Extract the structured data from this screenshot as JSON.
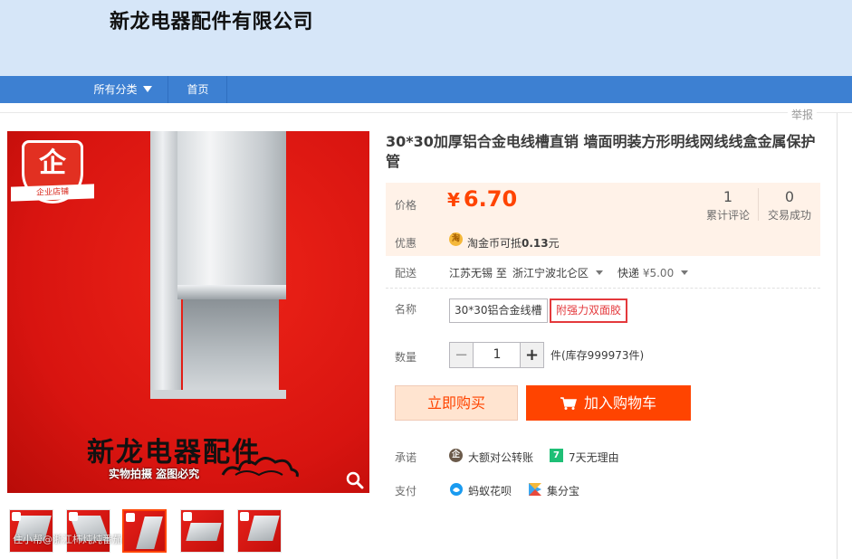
{
  "shop": {
    "name": "新龙电器配件有限公司"
  },
  "nav": {
    "all_categories": "所有分类",
    "home": "首页"
  },
  "report": "举报",
  "product": {
    "title": "30*30加厚铝合金电线槽直销 墙面明装方形明线网线线盒金属保护管",
    "image": {
      "badge_glyph": "企",
      "badge_text": "企业店铺",
      "calligraphy": "新龙电器配件",
      "slogan": "实物拍摄  盗图必究"
    },
    "thumbnails_count": 5,
    "active_thumbnail": 3,
    "watermark": "住小帮@浙江柿炖炖番茄"
  },
  "price": {
    "label": "价格",
    "currency": "¥",
    "value": "6.70",
    "reviews_count": "1",
    "reviews_label": "累计评论",
    "sales_count": "0",
    "sales_label": "交易成功"
  },
  "promo": {
    "label": "优惠",
    "icon_text": "淘",
    "text_prefix": "淘金币可抵",
    "amount": "0.13",
    "text_suffix": "元"
  },
  "shipping": {
    "label": "配送",
    "from": "江苏无锡 至",
    "to": "浙江宁波北仑区",
    "method": "快递",
    "fee": "¥5.00"
  },
  "sku": {
    "label": "名称",
    "options": [
      "30*30铝合金线槽",
      "附强力双面胶"
    ],
    "selected_index": 1
  },
  "quantity": {
    "label": "数量",
    "value": "1",
    "minus": "−",
    "plus": "+",
    "stock_text": "件(库存999973件)"
  },
  "buttons": {
    "buy_now": "立即购买",
    "add_to_cart": "加入购物车"
  },
  "promise": {
    "label": "承诺",
    "items": [
      "大额对公转账",
      "7天无理由"
    ],
    "icon_1": "企",
    "icon_2": "7"
  },
  "payment": {
    "label": "支付",
    "items": [
      "蚂蚁花呗",
      "集分宝"
    ]
  },
  "colors": {
    "accent": "#ff4400",
    "nav": "#3d80d2",
    "header_bg": "#d6e6f8",
    "price_bg": "#fff2e8"
  }
}
